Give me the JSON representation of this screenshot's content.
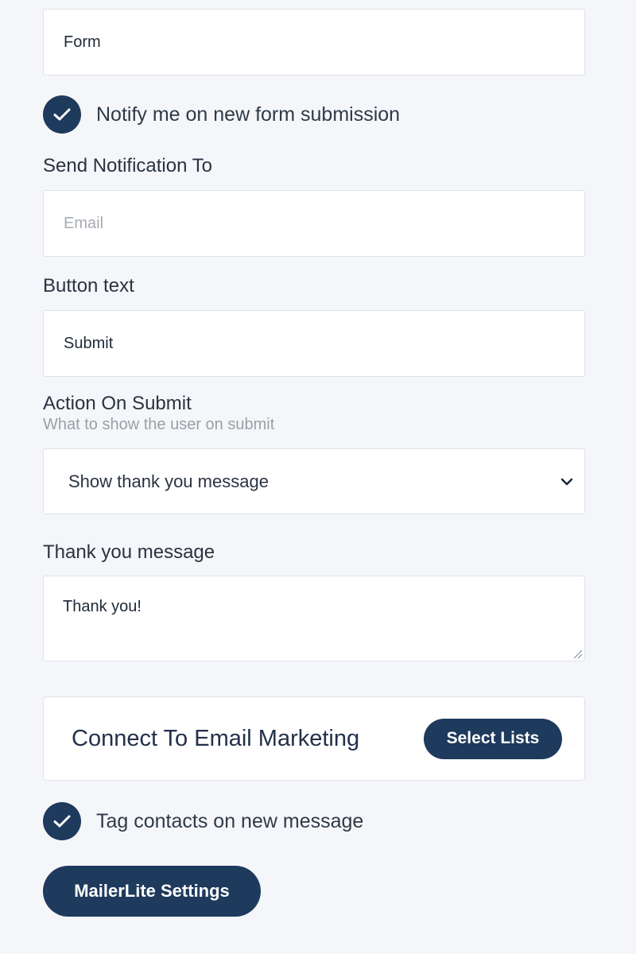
{
  "form_name": {
    "value": "Form"
  },
  "notify": {
    "checked": true,
    "label": "Notify me on new form submission"
  },
  "send_notification": {
    "label": "Send Notification To",
    "placeholder": "Email",
    "value": ""
  },
  "button_text": {
    "label": "Button text",
    "value": "Submit"
  },
  "action_on_submit": {
    "label": "Action On Submit",
    "sublabel": "What to show the user on submit",
    "selected": "Show thank you message"
  },
  "thank_you": {
    "label": "Thank you message",
    "value": "Thank you!"
  },
  "email_marketing": {
    "title": "Connect To Email Marketing",
    "button_label": "Select Lists"
  },
  "tag_contacts": {
    "checked": true,
    "label": "Tag contacts on new message"
  },
  "mailerlite_button": "MailerLite Settings",
  "colors": {
    "accent": "#1e3a5c",
    "background": "#f5f6f9"
  },
  "icons": {
    "checkbox": "check-icon",
    "select": "chevron-down-icon"
  }
}
